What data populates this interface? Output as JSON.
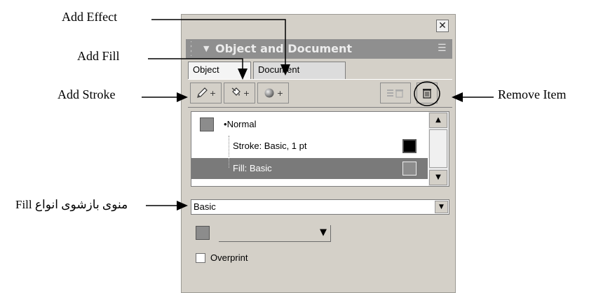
{
  "callouts": {
    "add_effect": "Add Effect",
    "add_fill": "Add Fill",
    "add_stroke": "Add Stroke",
    "remove_item": "Remove Item",
    "fill_types_menu": "منوی بازشوی انواع Fill"
  },
  "panel": {
    "title": "Object and Document",
    "close_icon": "close-icon",
    "menu_icon": "panel-options-menu-icon",
    "tabs": [
      {
        "label": "Object",
        "active": true
      },
      {
        "label": "Document",
        "active": false
      }
    ],
    "toolbar": {
      "add_stroke_icon": "pencil-icon",
      "add_fill_icon": "paint-bucket-icon",
      "add_effect_icon": "effect-sphere-icon",
      "duplicate_icon": "list-trash-icon",
      "remove_icon": "trash-icon",
      "plus": "+"
    },
    "attributes": [
      {
        "label": "Normal",
        "swatch": "#8c8c8c",
        "selected": false
      },
      {
        "label": "Stroke: Basic, 1 pt",
        "swatch": "#000000",
        "selected": false
      },
      {
        "label": "Fill: Basic",
        "swatch": "#8c8c8c",
        "selected": true
      }
    ],
    "fill_type": {
      "value": "Basic"
    },
    "fill_color": {
      "swatch": "#8c8c8c"
    },
    "overprint": {
      "label": "Overprint",
      "checked": false
    }
  }
}
